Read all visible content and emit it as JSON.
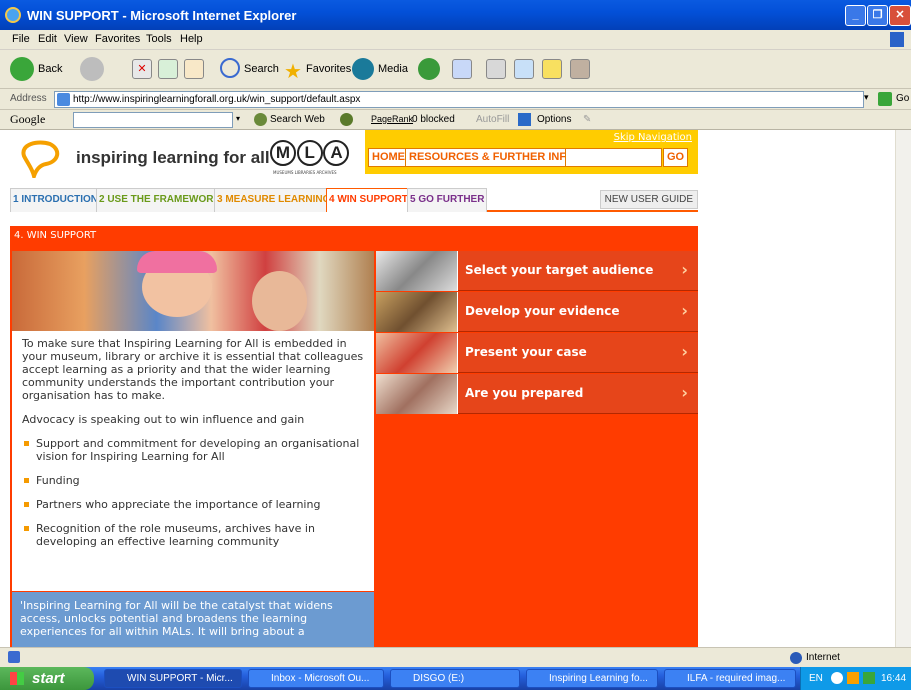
{
  "window": {
    "title": "WIN SUPPORT - Microsoft Internet Explorer"
  },
  "menubar": [
    "File",
    "Edit",
    "View",
    "Favorites",
    "Tools",
    "Help"
  ],
  "toolbar": {
    "back": "Back",
    "search": "Search",
    "favorites": "Favorites",
    "media": "Media"
  },
  "address": {
    "label": "Address",
    "url": "http://www.inspiringlearningforall.org.uk/win_support/default.aspx",
    "go": "Go"
  },
  "googlebar": {
    "brand": "Google",
    "search_web": "Search Web",
    "pagerank": "PageRank",
    "blocked": "0 blocked",
    "autofill": "AutoFill",
    "options": "Options"
  },
  "site": {
    "brand": "inspiring learning for all",
    "mla_letters": [
      "M",
      "L",
      "A"
    ],
    "mla_subtitle": "MUSEUMS LIBRARIES ARCHIVES",
    "skip": "Skip Navigation",
    "home": "HOME",
    "resources": "RESOURCES & FURTHER INFO",
    "go": "GO",
    "tabs": [
      {
        "label": "1 INTRODUCTION",
        "color": "#2a6fb0"
      },
      {
        "label": "2 USE THE FRAMEWORK",
        "color": "#6a9a1a"
      },
      {
        "label": "3 MEASURE LEARNING",
        "color": "#e08a00"
      },
      {
        "label": "4 WIN SUPPORT",
        "color": "#ff3c00"
      },
      {
        "label": "5 GO FURTHER",
        "color": "#7a2f8a"
      }
    ],
    "new_user_guide": "NEW USER GUIDE",
    "section_title": "4. WIN SUPPORT",
    "intro": "To make sure that Inspiring Learning for All is embedded in your museum, library or archive it is essential that colleagues accept learning as a priority and that the wider learning community understands the important contribution your organisation has to make.",
    "advocacy": "Advocacy is speaking out to win influence and gain",
    "bullets": [
      "Support and commitment for developing an organisational vision for Inspiring Learning for All",
      "Funding",
      "Partners who appreciate the importance of learning",
      "Recognition of the role museums, archives have in developing an effective learning community"
    ],
    "quote": "'Inspiring Learning for All will be the catalyst that widens access, unlocks potential and broadens the learning experiences for all within MALs. It will bring about a",
    "menu": [
      {
        "label": "Select your target audience"
      },
      {
        "label": "Develop your evidence"
      },
      {
        "label": "Present your case"
      },
      {
        "label": "Are you prepared"
      }
    ]
  },
  "status": {
    "zone": "Internet"
  },
  "taskbar": {
    "start": "start",
    "tasks": [
      "WIN SUPPORT - Micr...",
      "Inbox - Microsoft Ou...",
      "DISGO (E:)",
      "Inspiring Learning fo...",
      "ILFA - required imag..."
    ],
    "lang": "EN",
    "time": "16:44"
  }
}
